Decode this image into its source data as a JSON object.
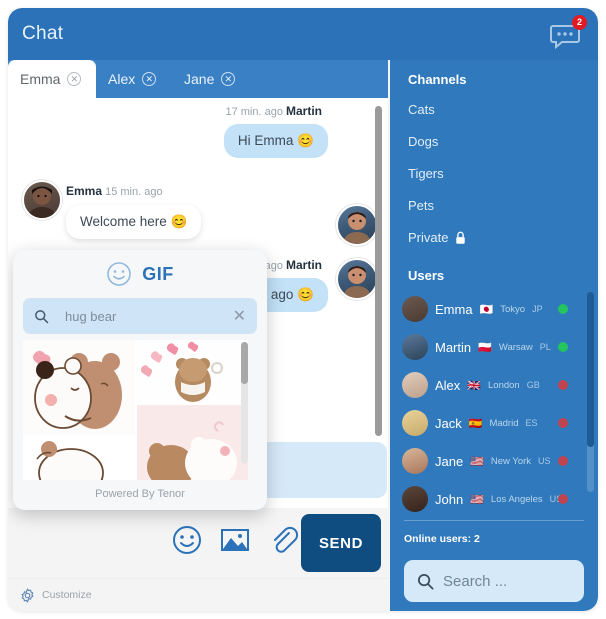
{
  "header": {
    "title": "Chat",
    "notification_count": "2",
    "chat_icon": "chat-bubble-icon"
  },
  "tabs": [
    {
      "label": "Emma",
      "active": true,
      "close_icon": "close-icon"
    },
    {
      "label": "Alex",
      "active": false,
      "close_icon": "close-icon"
    },
    {
      "label": "Jane",
      "active": false,
      "close_icon": "close-icon"
    }
  ],
  "messages": [
    {
      "author": "Martin",
      "time": "17 min. ago",
      "text": "Hi Emma 😊",
      "side": "right"
    },
    {
      "author": "Emma",
      "time": "15 min. ago",
      "text": "Welcome here 😊",
      "side": "left"
    },
    {
      "author": "Martin",
      "time": "ago",
      "text": "days ago 😊",
      "side": "right"
    }
  ],
  "gif_popup": {
    "logo_text": "GIF",
    "smiley_icon": "smiley-icon",
    "search_icon": "search-icon",
    "search_value": "hug bear",
    "clear_icon": "close-icon",
    "credit": "Powered By Tenor"
  },
  "composer": {
    "input_value": "",
    "tools": [
      {
        "icon": "emoji-icon"
      },
      {
        "icon": "image-icon"
      },
      {
        "icon": "paperclip-icon"
      }
    ],
    "send_label": "SEND"
  },
  "footer": {
    "gear_icon": "gear-icon",
    "customize_label": "Customize"
  },
  "sidebar": {
    "channels_heading": "Channels",
    "channels": [
      {
        "label": "Cats",
        "locked": false
      },
      {
        "label": "Dogs",
        "locked": false
      },
      {
        "label": "Tigers",
        "locked": false
      },
      {
        "label": "Pets",
        "locked": false
      },
      {
        "label": "Private",
        "locked": true,
        "lock_icon": "lock-icon"
      }
    ],
    "users_heading": "Users",
    "users": [
      {
        "name": "Emma",
        "flag": "🇯🇵",
        "city": "Tokyo",
        "cc": "JP",
        "online": true
      },
      {
        "name": "Martin",
        "flag": "🇵🇱",
        "city": "Warsaw",
        "cc": "PL",
        "online": true
      },
      {
        "name": "Alex",
        "flag": "🇬🇧",
        "city": "London",
        "cc": "GB",
        "online": false
      },
      {
        "name": "Jack",
        "flag": "🇪🇸",
        "city": "Madrid",
        "cc": "ES",
        "online": false
      },
      {
        "name": "Jane",
        "flag": "🇺🇸",
        "city": "New York",
        "cc": "US",
        "online": false
      },
      {
        "name": "John",
        "flag": "🇺🇸",
        "city": "Los Angeles",
        "cc": "US",
        "online": false
      }
    ],
    "online_users_label": "Online users: 2",
    "search_icon": "search-icon",
    "search_placeholder": "Search ..."
  },
  "colors": {
    "header_blue": "#2b72b8",
    "tabbar_blue": "#3a80c4",
    "sidebar_blue": "#2f79bc",
    "send_blue": "#0f4d80",
    "bubble_them": "#c3e1f7",
    "badge_red": "#e01b24",
    "online_green": "#22c55e",
    "offline_red": "#c0444f"
  }
}
